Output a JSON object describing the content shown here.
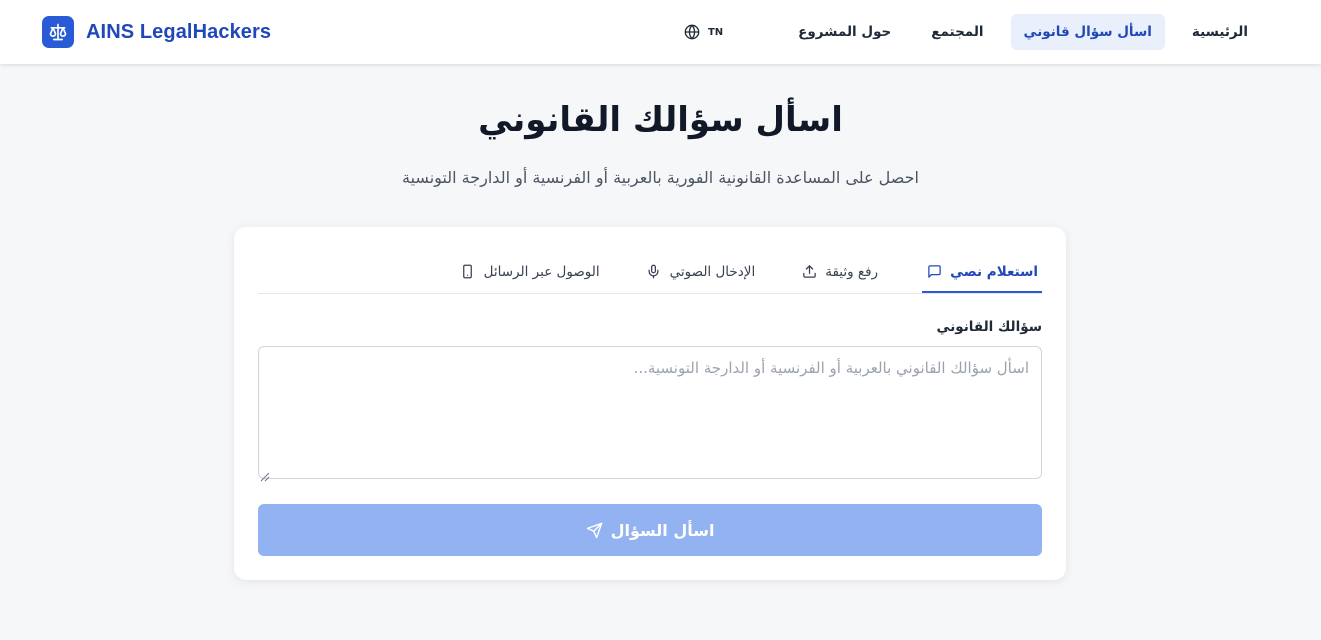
{
  "brand": {
    "name": "AINS LegalHackers",
    "icon": "scale-icon",
    "color": "#2a5bd7"
  },
  "nav": {
    "items": [
      {
        "label": "الرئيسية",
        "active": false
      },
      {
        "label": "اسأل سؤال قانوني",
        "active": true
      },
      {
        "label": "المجتمع",
        "active": false
      },
      {
        "label": "حول المشروع",
        "active": false
      }
    ],
    "lang_code": "TN",
    "lang_icon": "globe-icon"
  },
  "header": {
    "title": "اسأل سؤالك القانوني",
    "subtitle": "احصل على المساعدة القانونية الفورية بالعربية أو الفرنسية أو الدارجة التونسية"
  },
  "tabs": [
    {
      "label": "استعلام نصي",
      "icon": "message-icon",
      "active": true
    },
    {
      "label": "رفع وثيقة",
      "icon": "upload-icon",
      "active": false
    },
    {
      "label": "الإدخال الصوتي",
      "icon": "microphone-icon",
      "active": false
    },
    {
      "label": "الوصول عبر الرسائل",
      "icon": "phone-icon",
      "active": false
    }
  ],
  "form": {
    "label": "سؤالك القانوني",
    "placeholder": "اسأل سؤالك القانوني بالعربية أو الفرنسية أو الدارجة التونسية...",
    "value": "",
    "submit_label": "اسأل السؤال",
    "submit_icon": "send-icon",
    "submit_color": "#93b2f2"
  },
  "colors": {
    "accent": "#2a5bd7",
    "background": "#f6f7f9"
  }
}
